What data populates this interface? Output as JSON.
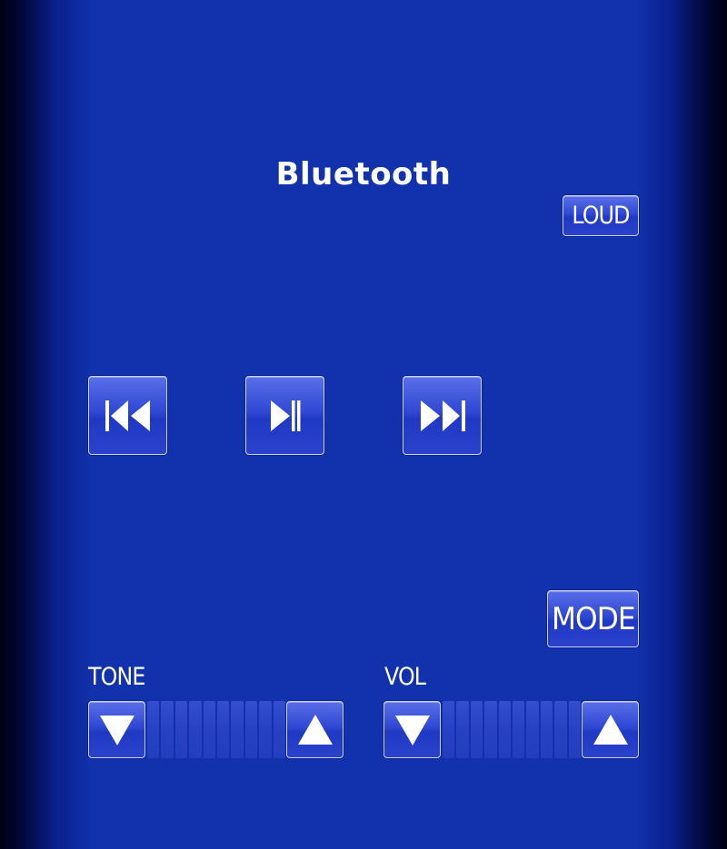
{
  "header": {
    "title": "Bluetooth"
  },
  "buttons": {
    "loud": "LOUD",
    "mode": "MODE",
    "prev_icon": "skip-previous-icon",
    "play_pause_icon": "play-pause-icon",
    "next_icon": "skip-next-icon"
  },
  "tone": {
    "label": "TONE",
    "segments": 10,
    "down_icon": "triangle-down-icon",
    "up_icon": "triangle-up-icon"
  },
  "volume": {
    "label": "VOL",
    "segments": 10,
    "down_icon": "triangle-down-icon",
    "up_icon": "triangle-up-icon"
  },
  "colors": {
    "background": "#1132ac",
    "button": "#3048d4",
    "button_border": "#c9d2ff",
    "text": "#ffffff"
  }
}
